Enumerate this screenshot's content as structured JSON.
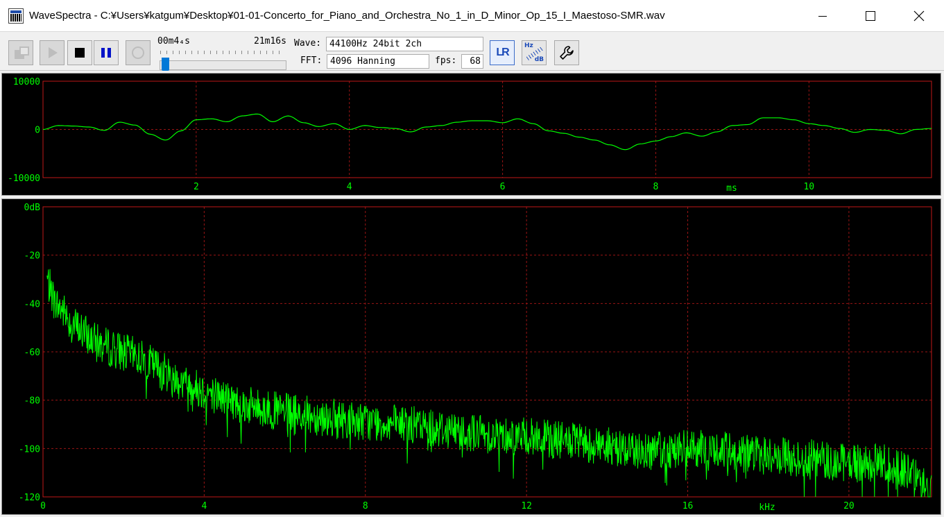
{
  "window": {
    "title": "WaveSpectra - C:¥Users¥katgum¥Desktop¥01-01-Concerto_for_Piano_and_Orchestra_No_1_in_D_Minor_Op_15_I_Maestoso-SMR.wav",
    "app_icon": "wavespectra-app-icon",
    "controls": [
      "minimize-icon",
      "maximize-icon",
      "close-icon"
    ]
  },
  "toolbar": {
    "position_text": "00m4₄s",
    "duration_text": "21m16s",
    "seek_fraction": 0.003,
    "wave_label": "Wave:",
    "wave_value": "44100Hz 24bit 2ch",
    "fft_label": "FFT:",
    "fft_value": "4096 Hanning",
    "fps_label": "fps:",
    "fps_value": "68",
    "buttons": {
      "open": "open-file-icon",
      "play": "play-icon",
      "stop": "stop-icon",
      "pause": "pause-icon",
      "record": "record-icon",
      "lr": "lr-channel-icon",
      "scale": "hz-db-scale-icon",
      "settings": "wrench-icon"
    }
  },
  "chart_data": [
    {
      "type": "line",
      "yunit_label": "",
      "xunit_label": "ms",
      "xlim": [
        0,
        11.6
      ],
      "ylim": [
        -10000,
        10000
      ],
      "yticks": [
        {
          "value": 10000,
          "label": "10000"
        },
        {
          "value": 0,
          "label": "0"
        },
        {
          "value": -10000,
          "label": "-10000"
        }
      ],
      "xticks": [
        {
          "value": 2,
          "label": "2"
        },
        {
          "value": 4,
          "label": "4"
        },
        {
          "value": 6,
          "label": "6"
        },
        {
          "value": 8,
          "label": "8"
        },
        {
          "value": 10,
          "label": "10"
        }
      ],
      "grid": true,
      "line_color": "#00ff00",
      "series": [
        {
          "x": [
            0,
            0.2,
            0.4,
            0.6,
            0.8,
            1.0,
            1.2,
            1.4,
            1.6,
            1.8,
            2.0,
            2.2,
            2.4,
            2.6,
            2.8,
            3.0,
            3.2,
            3.4,
            3.6,
            3.8,
            4.0,
            4.2,
            4.4,
            4.6,
            4.8,
            5.0,
            5.2,
            5.4,
            5.6,
            5.8,
            6.0,
            6.2,
            6.4,
            6.6,
            6.8,
            7.0,
            7.2,
            7.4,
            7.6,
            7.8,
            8.0,
            8.2,
            8.4,
            8.6,
            8.8,
            9.0,
            9.2,
            9.4,
            9.6,
            9.8,
            10.0,
            10.2,
            10.4,
            10.6,
            10.8,
            11.0,
            11.2,
            11.4,
            11.6
          ],
          "y": [
            0,
            800,
            700,
            500,
            -200,
            1500,
            900,
            -1000,
            -2200,
            -300,
            2000,
            2200,
            1600,
            2800,
            3200,
            1600,
            2800,
            1400,
            600,
            1200,
            0,
            800,
            400,
            200,
            -500,
            500,
            800,
            1500,
            1800,
            1800,
            1400,
            2200,
            1200,
            -300,
            -800,
            -1600,
            -2200,
            -3200,
            -4200,
            -3000,
            -2400,
            -1500,
            -700,
            -1400,
            -500,
            800,
            1000,
            2400,
            2400,
            2000,
            1200,
            800,
            200,
            -600,
            0,
            -200,
            -900,
            0,
            200
          ]
        }
      ]
    },
    {
      "type": "line",
      "xunit_label": "kHz",
      "xlim": [
        0,
        22.05
      ],
      "ylim": [
        -120,
        0
      ],
      "yticks": [
        {
          "value": 0,
          "label": "0dB"
        },
        {
          "value": -20,
          "label": "-20"
        },
        {
          "value": -40,
          "label": "-40"
        },
        {
          "value": -60,
          "label": "-60"
        },
        {
          "value": -80,
          "label": "-80"
        },
        {
          "value": -100,
          "label": "-100"
        },
        {
          "value": -120,
          "label": "-120"
        }
      ],
      "xticks": [
        {
          "value": 0,
          "label": "0"
        },
        {
          "value": 4,
          "label": "4"
        },
        {
          "value": 8,
          "label": "8"
        },
        {
          "value": 12,
          "label": "12"
        },
        {
          "value": 16,
          "label": "16"
        },
        {
          "value": 20,
          "label": "20"
        }
      ],
      "grid": true,
      "line_color": "#00ff00",
      "series": [
        {
          "x": [
            0.1,
            0.2,
            0.3,
            0.5,
            0.7,
            1.0,
            1.3,
            1.6,
            2.0,
            2.5,
            3.0,
            3.5,
            4.0,
            5.0,
            6.0,
            7.0,
            8.0,
            9.0,
            10.0,
            11.0,
            12.0,
            13.0,
            14.0,
            15.0,
            16.0,
            17.0,
            18.0,
            19.0,
            20.0,
            21.0,
            21.5,
            22.05
          ],
          "y": [
            -30,
            -35,
            -40,
            -43,
            -48,
            -52,
            -56,
            -58,
            -60,
            -63,
            -68,
            -73,
            -76,
            -82,
            -85,
            -87,
            -89,
            -90,
            -92,
            -94,
            -95,
            -97,
            -99,
            -101,
            -100,
            -101,
            -103,
            -104,
            -106,
            -106,
            -110,
            -118
          ]
        }
      ]
    }
  ]
}
